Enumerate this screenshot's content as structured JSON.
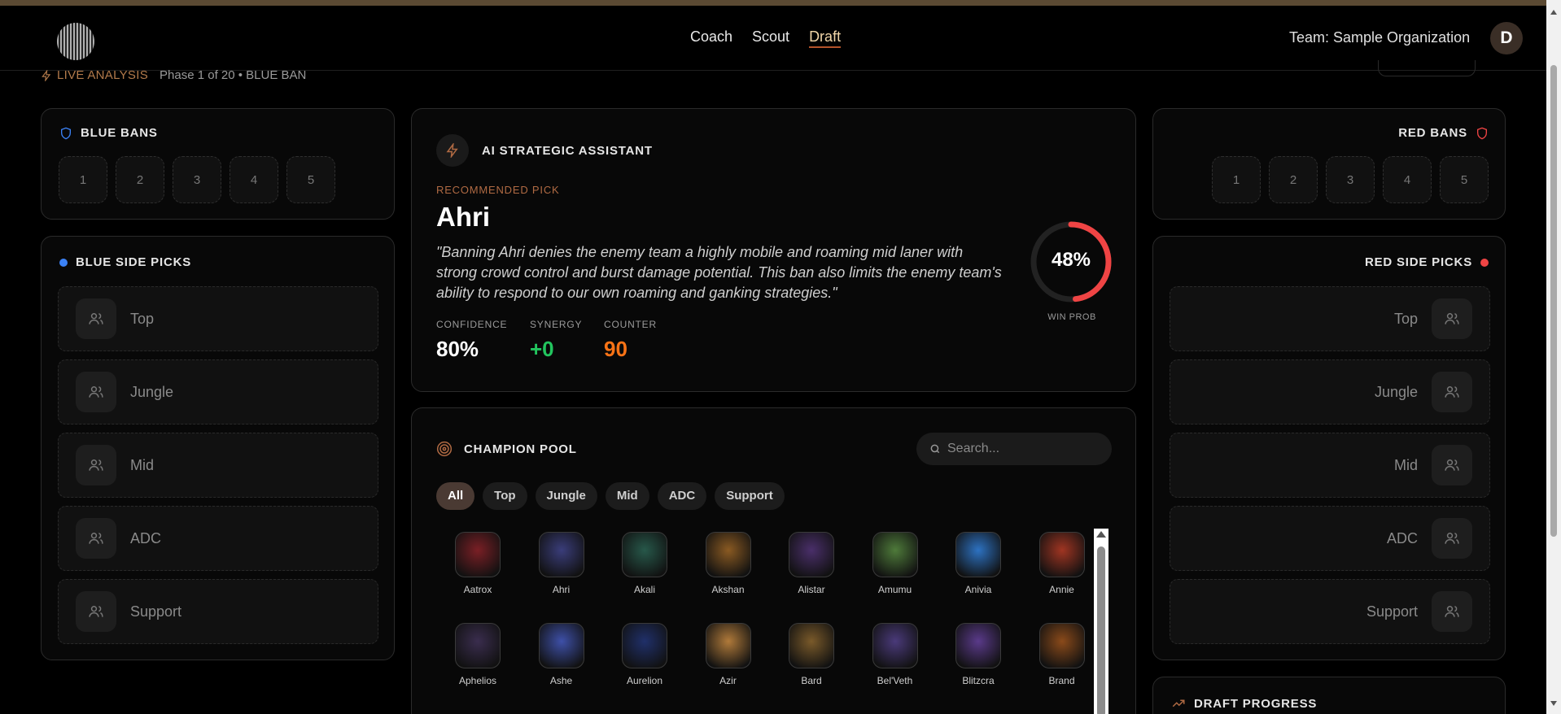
{
  "nav": {
    "links": [
      "Coach",
      "Scout",
      "Draft"
    ],
    "active": "Draft",
    "team_label": "Team: Sample Organization",
    "avatar_initial": "D"
  },
  "status": {
    "live_label": "LIVE ANALYSIS",
    "phase_text": "Phase 1 of 20 • BLUE BAN"
  },
  "blue_bans": {
    "title": "BLUE BANS",
    "slots": [
      "1",
      "2",
      "3",
      "4",
      "5"
    ]
  },
  "red_bans": {
    "title": "RED BANS",
    "slots": [
      "1",
      "2",
      "3",
      "4",
      "5"
    ]
  },
  "blue_picks": {
    "title": "BLUE SIDE PICKS",
    "roles": [
      "Top",
      "Jungle",
      "Mid",
      "ADC",
      "Support"
    ]
  },
  "red_picks": {
    "title": "RED SIDE PICKS",
    "roles": [
      "Top",
      "Jungle",
      "Mid",
      "ADC",
      "Support"
    ]
  },
  "assistant": {
    "title": "AI STRATEGIC ASSISTANT",
    "recommended_label": "RECOMMENDED PICK",
    "champion": "Ahri",
    "quote": "\"Banning Ahri denies the enemy team a highly mobile and roaming mid laner with strong crowd control and burst damage potential. This ban also limits the enemy team's ability to respond to our own roaming and ganking strategies.\"",
    "stats": {
      "confidence": {
        "label": "CONFIDENCE",
        "value": "80%"
      },
      "synergy": {
        "label": "SYNERGY",
        "value": "+0"
      },
      "counter": {
        "label": "COUNTER",
        "value": "90"
      }
    },
    "win_prob": {
      "value": "48%",
      "fraction": 0.48,
      "label": "WIN PROB"
    }
  },
  "champion_pool": {
    "title": "CHAMPION POOL",
    "search_placeholder": "Search...",
    "filters": [
      "All",
      "Top",
      "Jungle",
      "Mid",
      "ADC",
      "Support"
    ],
    "active_filter": "All",
    "champions": [
      {
        "name": "Aatrox",
        "color": "#7a1f25"
      },
      {
        "name": "Ahri",
        "color": "#3a3d7a"
      },
      {
        "name": "Akali",
        "color": "#27584a"
      },
      {
        "name": "Akshan",
        "color": "#8a5a22"
      },
      {
        "name": "Alistar",
        "color": "#4a2f6a"
      },
      {
        "name": "Amumu",
        "color": "#4e7a3a"
      },
      {
        "name": "Anivia",
        "color": "#2d72c2"
      },
      {
        "name": "Annie",
        "color": "#a03522"
      },
      {
        "name": "Aphelios",
        "color": "#3a2d4e"
      },
      {
        "name": "Ashe",
        "color": "#3e50a8"
      },
      {
        "name": "Aurelion",
        "color": "#20306a"
      },
      {
        "name": "Azir",
        "color": "#b07a3a"
      },
      {
        "name": "Bard",
        "color": "#7a5a2a"
      },
      {
        "name": "Bel'Veth",
        "color": "#4a3a7a"
      },
      {
        "name": "Blitzcra",
        "color": "#5a3a8a"
      },
      {
        "name": "Brand",
        "color": "#8a4a1a"
      }
    ]
  },
  "draft_progress": {
    "title": "DRAFT PROGRESS"
  },
  "colors": {
    "blue": "#3b82f6",
    "red": "#ef4444",
    "accent": "#b4532a",
    "synergy": "#22c55e",
    "counter": "#f97316"
  }
}
